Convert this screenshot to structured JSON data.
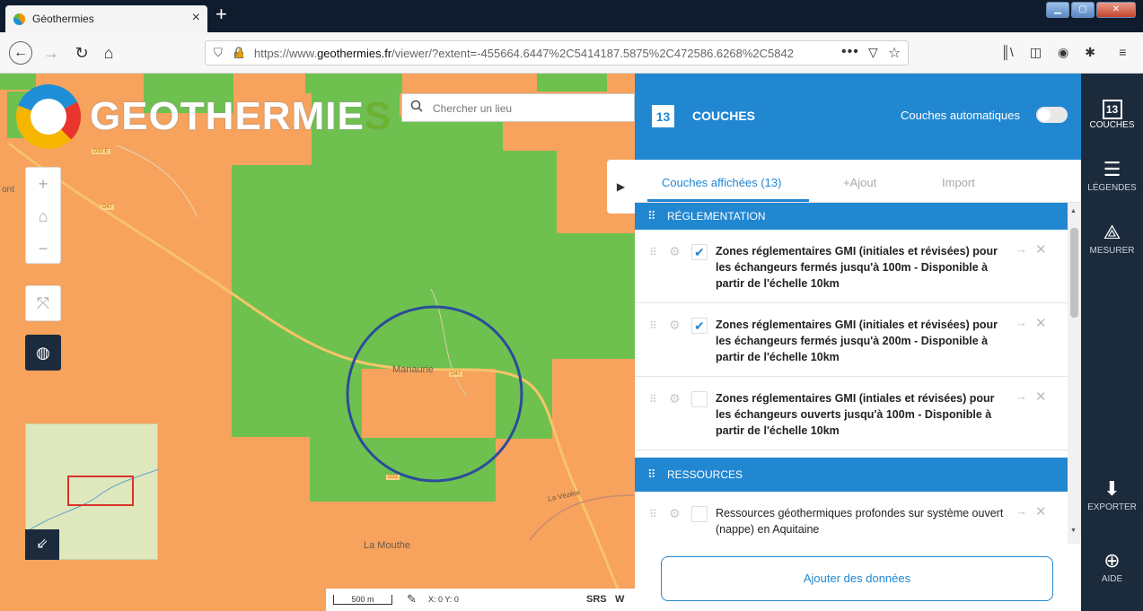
{
  "browser": {
    "tab_title": "Géothermies",
    "tab_close": "×",
    "new_tab": "+",
    "url_prefix": "https://www.",
    "url_domain": "geothermies.fr",
    "url_rest": "/viewer/?extent=-455664.6447%2C5414187.5875%2C472586.6268%2C5842",
    "url_more": "•••"
  },
  "map": {
    "logo_text_main": "GEOTHERMIE",
    "logo_text_last": "S",
    "search_placeholder": "Chercher un lieu",
    "place_manaurie": "Manaurie",
    "place_la_mouthe": "La Mouthe",
    "place_la_vezere": "La Vézère",
    "place_left_edge": "ont",
    "road_d47_top": "D47",
    "road_d47_mid": "D47",
    "road_d32": "D32 E",
    "road_d31": "D31",
    "scale_label": "500 m",
    "coords_label": "X: 0 Y: 0",
    "srs_label": "SRS",
    "w_label": "W",
    "colors": {
      "orange_zone": "#f7a25d",
      "green_zone": "#6ec14f",
      "circle": "#2b4d9b"
    }
  },
  "panel": {
    "badge_count": "13",
    "title": "COUCHES",
    "auto_label": "Couches automatiques",
    "tabs": [
      {
        "label": "Couches affichées (13)"
      },
      {
        "label": "+Ajout"
      },
      {
        "label": "Import"
      }
    ],
    "sections": [
      {
        "label": "RÉGLEMENTATION"
      },
      {
        "label": "RESSOURCES"
      }
    ],
    "layers": [
      {
        "name": "Zones réglementaires GMI (initiales et révisées) pour les échangeurs fermés jusqu'à 100m - Disponible à partir de l'échelle 10km",
        "checked": "✔"
      },
      {
        "name": "Zones réglementaires GMI (initiales et révisées) pour les échangeurs fermés jusqu'à 200m - Disponible à partir de l'échelle 10km",
        "checked": "✔"
      },
      {
        "name": "Zones réglementaires GMI (intiales et révisées) pour les échangeurs ouverts jusqu'à 100m - Disponible à partir de l'échelle 10km",
        "checked": ""
      },
      {
        "name": "Ressources géothermiques profondes sur système ouvert (nappe) en Aquitaine",
        "checked": ""
      }
    ],
    "add_data_label": "Ajouter des données",
    "accent": "#2187d1"
  },
  "toolbar": {
    "couches_badge": "13",
    "couches_label": "COUCHES",
    "legendes_label": "LÉGENDES",
    "mesurer_label": "MESURER",
    "exporter_label": "EXPORTER",
    "aide_label": "AIDE"
  }
}
